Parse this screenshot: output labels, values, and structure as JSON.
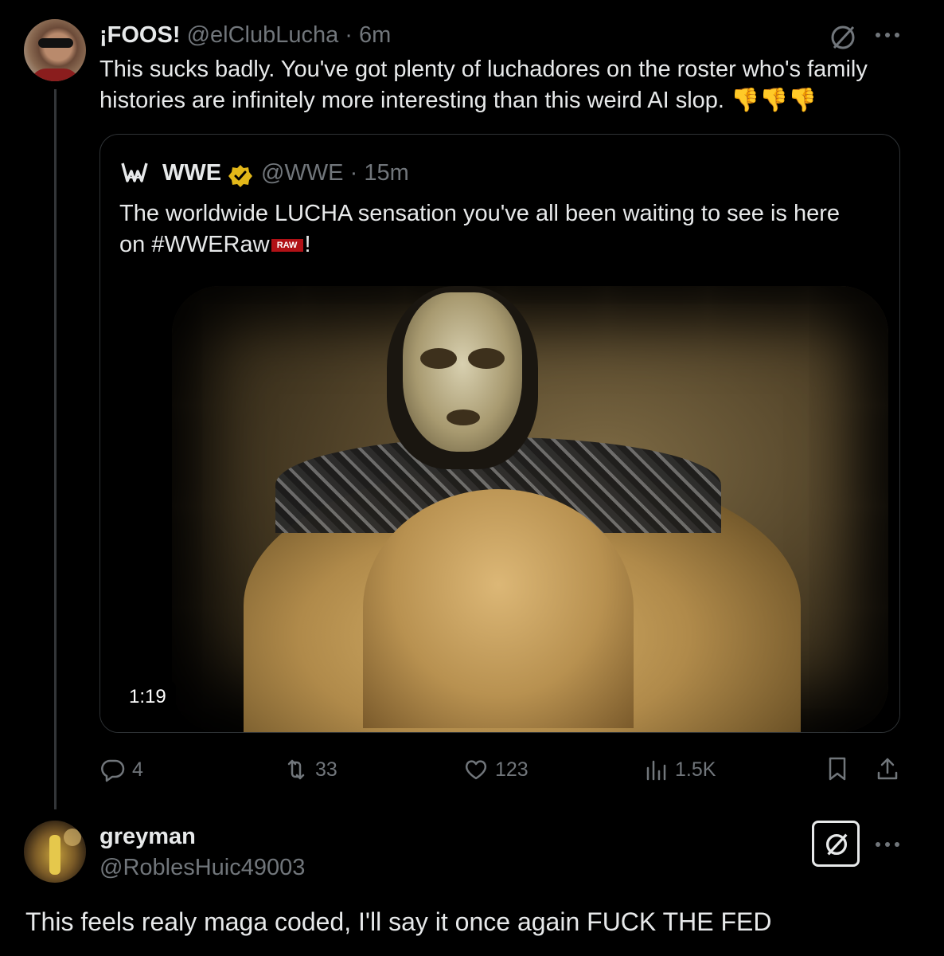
{
  "post": {
    "display_name": "¡FOOS!",
    "handle": "@elClubLucha",
    "separator": "·",
    "time": "6m",
    "text_line1": "This sucks badly. You've got plenty of luchadores on the roster who's family",
    "text_line2": "histories are infinitely more interesting than this weird AI slop.",
    "emoji": "👎👎👎"
  },
  "quote": {
    "display_name": "WWE",
    "handle": "@WWE",
    "separator": "·",
    "time": "15m",
    "text_line1": "The worldwide LUCHA sensation you've all been waiting to see is here",
    "text_line2_prefix": "on #WWERaw",
    "raw_badge": "RAW",
    "text_line2_suffix": "!",
    "video_duration": "1:19"
  },
  "actions": {
    "replies": "4",
    "reposts": "33",
    "likes": "123",
    "views": "1.5K"
  },
  "reply": {
    "display_name": "greyman",
    "handle": "@RoblesHuic49003",
    "text": "This feels realy maga coded, I'll say it once again FUCK THE FED"
  },
  "icons": [
    "grok-icon",
    "more-icon",
    "verified-badge-icon",
    "wwe-logo-icon",
    "reply-icon",
    "repost-icon",
    "like-icon",
    "views-icon",
    "bookmark-icon",
    "share-icon"
  ],
  "colors": {
    "background": "#000000",
    "text_primary": "#e7e9ea",
    "text_secondary": "#71767b",
    "border": "#2f3336",
    "verified_gold": "#e2b719",
    "raw_red": "#b11116"
  }
}
